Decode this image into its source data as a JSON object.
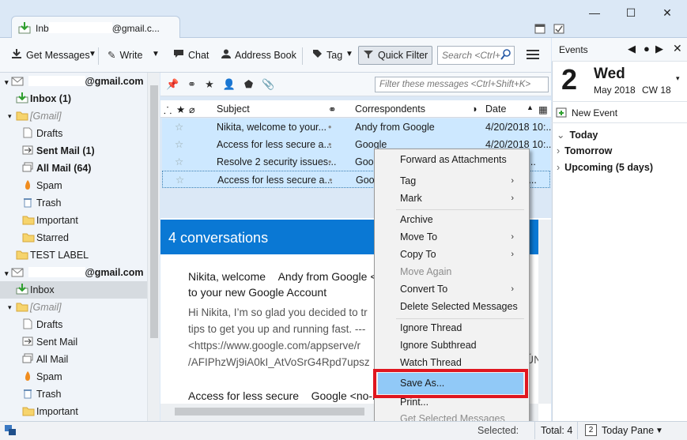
{
  "window": {
    "tab_title_prefix": "Inb",
    "tab_title_suffix": "@gmail.c...",
    "min_glyph": "—",
    "max_glyph": "☐",
    "close_glyph": "✕"
  },
  "toolbar": {
    "get_messages": "Get Messages",
    "write": "Write",
    "chat": "Chat",
    "address_book": "Address Book",
    "tag": "Tag",
    "quick_filter": "Quick Filter",
    "search_placeholder": "Search <Ctrl+"
  },
  "folders": {
    "account1": "@gmail.com",
    "items1": [
      {
        "label": "Inbox (1)",
        "bold": true
      },
      {
        "label": "[Gmail]",
        "italic": true
      },
      {
        "label": "Drafts"
      },
      {
        "label": "Sent Mail (1)",
        "bold": true
      },
      {
        "label": "All Mail (64)",
        "bold": true
      },
      {
        "label": "Spam"
      },
      {
        "label": "Trash"
      },
      {
        "label": "Important"
      },
      {
        "label": "Starred"
      },
      {
        "label": "TEST LABEL"
      }
    ],
    "account2": "@gmail.com",
    "items2": [
      {
        "label": "Inbox"
      },
      {
        "label": "[Gmail]",
        "italic": true
      },
      {
        "label": "Drafts"
      },
      {
        "label": "Sent Mail"
      },
      {
        "label": "All Mail"
      },
      {
        "label": "Spam"
      },
      {
        "label": "Trash"
      },
      {
        "label": "Important"
      }
    ]
  },
  "message_list": {
    "filter_placeholder": "Filter these messages <Ctrl+Shift+K>",
    "columns": {
      "subject": "Subject",
      "correspondents": "Correspondents",
      "date": "Date"
    },
    "rows": [
      {
        "subject": "Nikita, welcome to your...",
        "from": "Andy from Google",
        "date": "4/20/2018 10:..."
      },
      {
        "subject": "Access for less secure a...",
        "from": "Google",
        "date": "4/20/2018 10:..."
      },
      {
        "subject": "Resolve 2 security issues...",
        "from": "Goo",
        "date": "7:1..."
      },
      {
        "subject": "Access for less secure a...",
        "from": "Goo",
        "date": ":29..."
      }
    ]
  },
  "preview": {
    "header": "4 conversations",
    "conv1_subject_a": "Nikita, welcome",
    "conv1_from": "Andy from Google <",
    "conv1_subject_b": "to your new Google Account",
    "conv1_body": [
      "Hi Nikita, I’m so glad you decided to tr",
      "tips to get you up and running fast. ---",
      "<https://www.google.com/appserve/r",
      "/AFIPhzWj9iA0kI_AtVoSrG4Rpd7upsz"
    ],
    "conv1_body_tail": "ÚN",
    "conv2_subject": "Access for less secure",
    "conv2_from": "Google <no-r"
  },
  "today_pane": {
    "title": "Events",
    "day_number": "2",
    "weekday": "Wed",
    "month_year": "May 2018",
    "week": "CW 18",
    "new_event": "New Event",
    "sections": [
      "Today",
      "Tomorrow",
      "Upcoming (5 days)"
    ]
  },
  "context_menu": {
    "items": [
      {
        "label": "Forward as Attachments"
      },
      {
        "label": "Tag",
        "submenu": true
      },
      {
        "label": "Mark",
        "submenu": true
      },
      {
        "label": "Archive"
      },
      {
        "label": "Move To",
        "submenu": true
      },
      {
        "label": "Copy To",
        "submenu": true
      },
      {
        "label": "Move Again",
        "disabled": true
      },
      {
        "label": "Convert To",
        "submenu": true
      },
      {
        "label": "Delete Selected Messages"
      },
      {
        "label": "Ignore Thread"
      },
      {
        "label": "Ignore Subthread"
      },
      {
        "label": "Watch Thread"
      },
      {
        "label": "Save As...",
        "highlighted": true
      },
      {
        "label": "Print..."
      },
      {
        "label": "Get Selected Messages",
        "disabled": true
      }
    ]
  },
  "status": {
    "selected": "Selected:",
    "total": "Total: 4",
    "today_pane_day": "2",
    "today_pane": "Today Pane"
  },
  "colors": {
    "selection": "#cde8ff",
    "accent": "#0a78d4",
    "highlight_border": "#e0161f"
  }
}
